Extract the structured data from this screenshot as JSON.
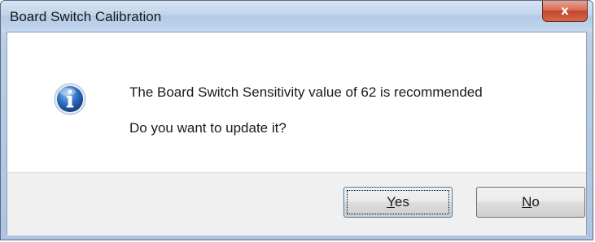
{
  "window": {
    "title": "Board Switch Calibration"
  },
  "title_bar": {
    "close_icon": "close-x",
    "close_glyph": "x"
  },
  "dialog": {
    "icon": "information-icon",
    "message_line1": "The Board Switch Sensitivity value of 62 is recommended",
    "message_line2": "Do you want to update it?"
  },
  "buttons": {
    "yes": {
      "mnemonic": "Y",
      "rest": "es",
      "label": "Yes",
      "default": true
    },
    "no": {
      "mnemonic": "N",
      "rest": "o",
      "label": "No",
      "default": false
    }
  },
  "colors": {
    "title_bar": "#c2d5ec",
    "close_button": "#c4452c",
    "info_icon": "#2d6fc2",
    "button_area": "#f0f0f0"
  }
}
